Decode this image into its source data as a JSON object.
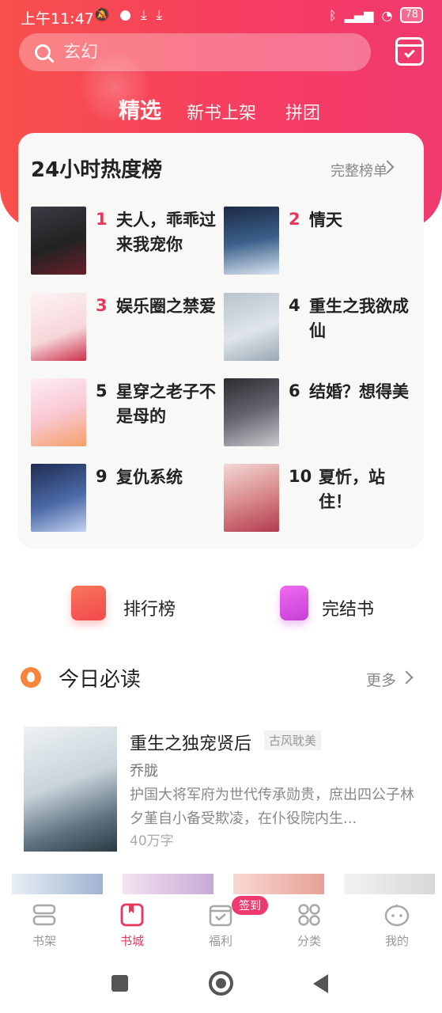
{
  "status_bar": {
    "time": "上午11:47",
    "left_icons": [
      "mute-icon",
      "chat-icon",
      "download-icon",
      "download-icon"
    ],
    "right_icons": [
      "bluetooth-icon",
      "signal-icon",
      "wifi-icon"
    ],
    "battery": "78"
  },
  "search": {
    "placeholder": "玄幻"
  },
  "top_tabs": [
    {
      "label": "精选",
      "active": true
    },
    {
      "label": "新书上架",
      "active": false
    },
    {
      "label": "拼团",
      "active": false
    }
  ],
  "ranking": {
    "title": "24小时热度榜",
    "more_label": "完整榜单",
    "items": [
      {
        "rank": "1",
        "title": "夫人，乖乖过来我宠你",
        "highlight": true
      },
      {
        "rank": "2",
        "title": "情天",
        "highlight": true
      },
      {
        "rank": "3",
        "title": "娱乐圈之禁爱",
        "highlight": true
      },
      {
        "rank": "4",
        "title": "重生之我欲成仙",
        "highlight": false
      },
      {
        "rank": "5",
        "title": "星穿之老子不是母的",
        "highlight": false
      },
      {
        "rank": "6",
        "title": "结婚？想得美",
        "highlight": false
      },
      {
        "rank": "9",
        "title": "复仇系统",
        "highlight": false
      },
      {
        "rank": "10",
        "title": "夏忻，站住！",
        "highlight": false
      }
    ]
  },
  "quick_links": [
    {
      "label": "排行榜",
      "icon": "ranking-icon"
    },
    {
      "label": "完结书",
      "icon": "finished-book-icon"
    }
  ],
  "today": {
    "title": "今日必读",
    "more_label": "更多",
    "book": {
      "title": "重生之独宠贤后",
      "tag": "古风耽美",
      "author": "乔胧",
      "description": "护国大将军府为世代传承勋贵，庶出四公子林夕堇自小备受欺凌，在仆役院内生...",
      "words": "40万字"
    }
  },
  "tab_bar": {
    "items": [
      {
        "label": "书架",
        "icon": "bookshelf-icon",
        "active": false
      },
      {
        "label": "书城",
        "icon": "bookstore-icon",
        "active": true
      },
      {
        "label": "福利",
        "icon": "calendar-check-icon",
        "active": false
      },
      {
        "label": "分类",
        "icon": "grid-icon",
        "active": false
      },
      {
        "label": "我的",
        "icon": "profile-face-icon",
        "active": false
      }
    ],
    "checkin_badge": "签到"
  },
  "colors": {
    "brand": "#f0396f",
    "hero_start": "#f8504c",
    "rank_highlight": "#e8375a"
  }
}
